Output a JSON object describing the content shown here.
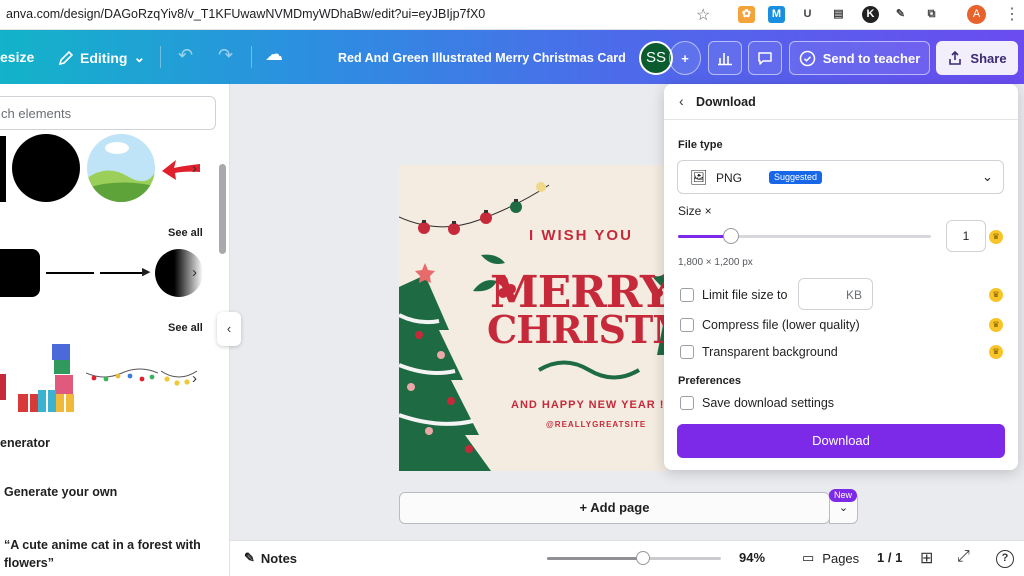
{
  "browser": {
    "url": "anva.com/design/DAGoRzqYiv8/v_T1KFUwawNVMDmyWDhaBw/edit?ui=eyJBIjp7fX0",
    "profile_initial": "A"
  },
  "header": {
    "resize_label": "esize",
    "editing_label": "Editing",
    "design_title": "Red And Green Illustrated Merry Christmas Card",
    "avatar_initials": "SS",
    "send_to_teacher_label": "Send to teacher",
    "share_label": "Share"
  },
  "sidebar": {
    "search_placeholder": "ch elements",
    "see_all_1": "See all",
    "see_all_2": "See all",
    "generator_label": "enerator",
    "generate_own_label": "Generate your own",
    "prompt_example_line1": "“A cute anime cat in a forest with",
    "prompt_example_line2": "flowers”"
  },
  "card": {
    "line1": "I WISH YOU",
    "merry": "MERRY",
    "christmas": "CHRISTMAS",
    "line2": "AND HAPPY NEW YEAR !",
    "handle": "@REALLYGREATSITE"
  },
  "canvas": {
    "add_page_label": "+ Add page",
    "new_badge": "New"
  },
  "bottombar": {
    "notes_label": "Notes",
    "zoom_value": "94%",
    "zoom_fraction": 0.55,
    "pages_label": "Pages",
    "page_count": "1 / 1"
  },
  "download": {
    "title": "Download",
    "file_type_label": "File type",
    "file_type_value": "PNG",
    "suggested_badge": "Suggested",
    "size_label": "Size ×",
    "size_value": "1",
    "size_fraction": 0.21,
    "dimensions": "1,800 × 1,200 px",
    "limit_file_size_label": "Limit file size to",
    "kb_unit": "KB",
    "compress_label": "Compress file (lower quality)",
    "transparent_label": "Transparent background",
    "preferences_label": "Preferences",
    "save_settings_label": "Save download settings",
    "download_button": "Download"
  },
  "colors": {
    "brand_purple": "#7d2ae8",
    "card_red": "#c62a3a",
    "card_green": "#1e6b43"
  }
}
